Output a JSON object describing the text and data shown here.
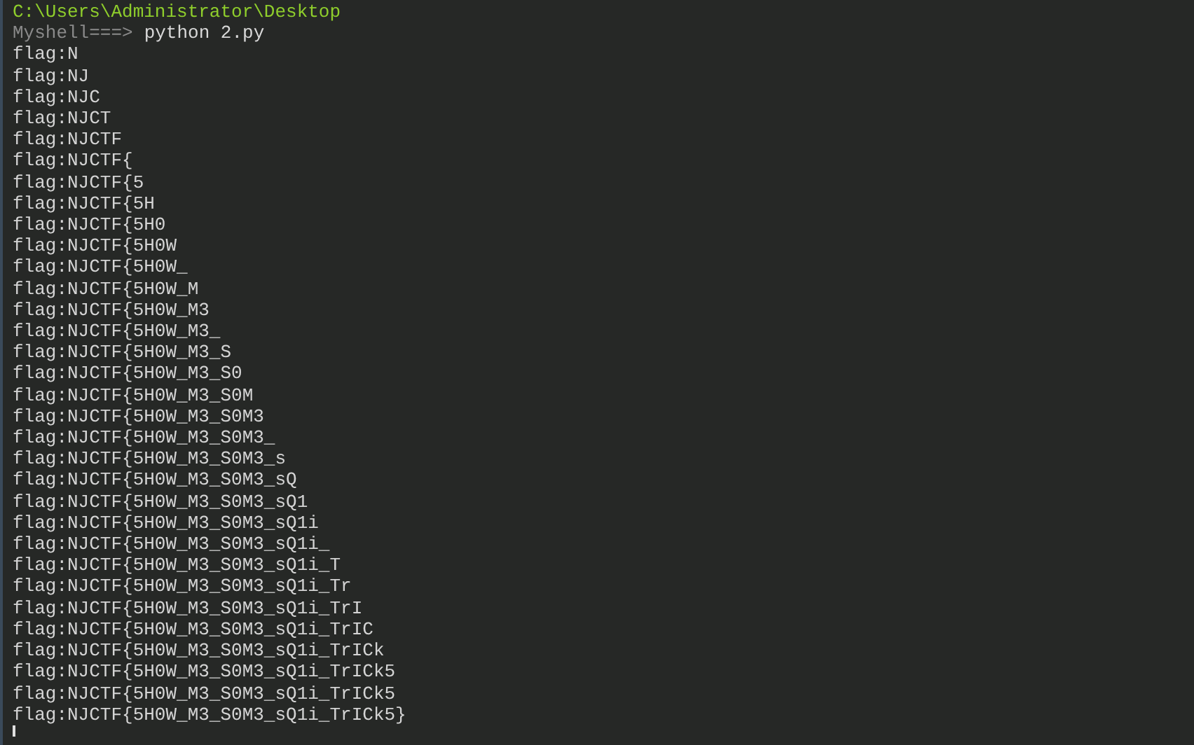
{
  "terminal": {
    "cwd": "C:\\Users\\Administrator\\Desktop",
    "prompt": "Myshell===>",
    "command": "python 2.py",
    "output": [
      "flag:N",
      "flag:NJ",
      "flag:NJC",
      "flag:NJCT",
      "flag:NJCTF",
      "flag:NJCTF{",
      "flag:NJCTF{5",
      "flag:NJCTF{5H",
      "flag:NJCTF{5H0",
      "flag:NJCTF{5H0W",
      "flag:NJCTF{5H0W_",
      "flag:NJCTF{5H0W_M",
      "flag:NJCTF{5H0W_M3",
      "flag:NJCTF{5H0W_M3_",
      "flag:NJCTF{5H0W_M3_S",
      "flag:NJCTF{5H0W_M3_S0",
      "flag:NJCTF{5H0W_M3_S0M",
      "flag:NJCTF{5H0W_M3_S0M3",
      "flag:NJCTF{5H0W_M3_S0M3_",
      "flag:NJCTF{5H0W_M3_S0M3_s",
      "flag:NJCTF{5H0W_M3_S0M3_sQ",
      "flag:NJCTF{5H0W_M3_S0M3_sQ1",
      "flag:NJCTF{5H0W_M3_S0M3_sQ1i",
      "flag:NJCTF{5H0W_M3_S0M3_sQ1i_",
      "flag:NJCTF{5H0W_M3_S0M3_sQ1i_T",
      "flag:NJCTF{5H0W_M3_S0M3_sQ1i_Tr",
      "flag:NJCTF{5H0W_M3_S0M3_sQ1i_TrI",
      "flag:NJCTF{5H0W_M3_S0M3_sQ1i_TrIC",
      "flag:NJCTF{5H0W_M3_S0M3_sQ1i_TrICk",
      "flag:NJCTF{5H0W_M3_S0M3_sQ1i_TrICk5",
      "flag:NJCTF{5H0W_M3_S0M3_sQ1i_TrICk5",
      "flag:NJCTF{5H0W_M3_S0M3_sQ1i_TrICk5}"
    ]
  }
}
